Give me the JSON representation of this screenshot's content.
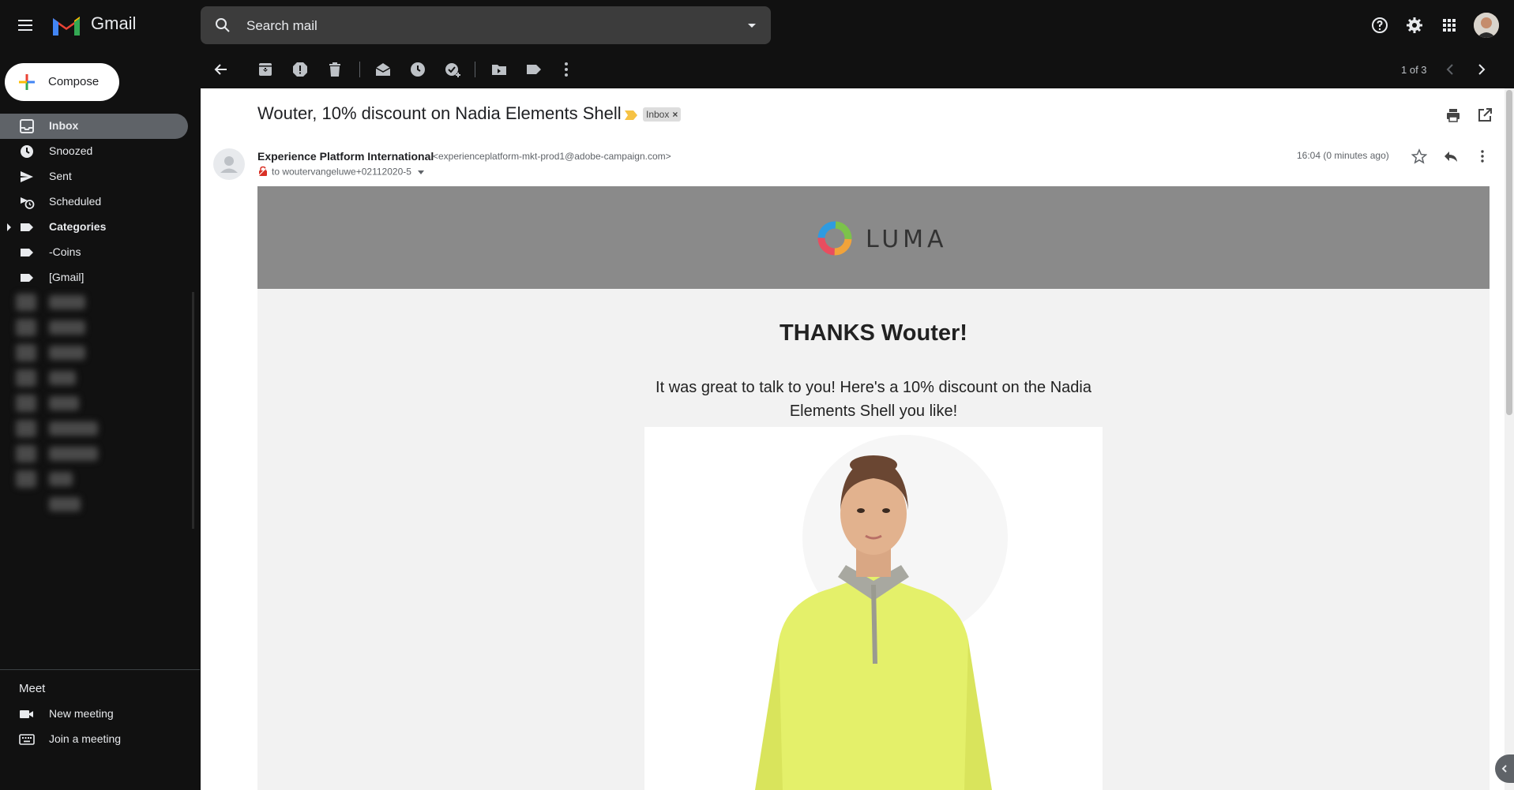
{
  "app": {
    "logo_label": "Gmail",
    "search_placeholder": "Search mail"
  },
  "compose_label": "Compose",
  "sidebar": {
    "items": [
      {
        "label": "Inbox",
        "icon": "inbox-icon",
        "active": true,
        "bold": true
      },
      {
        "label": "Snoozed",
        "icon": "clock-icon"
      },
      {
        "label": "Sent",
        "icon": "send-icon"
      },
      {
        "label": "Scheduled",
        "icon": "scheduled-icon"
      },
      {
        "label": "Categories",
        "icon": "label-icon",
        "bold": true,
        "expandable": true
      },
      {
        "label": "-Coins",
        "icon": "label-icon"
      },
      {
        "label": "[Gmail]",
        "icon": "label-icon"
      }
    ],
    "meet": {
      "title": "Meet",
      "new_meeting": "New meeting",
      "join_meeting": "Join a meeting"
    }
  },
  "toolbar": {
    "count": "1 of 3"
  },
  "email": {
    "subject": "Wouter, 10% discount on Nadia Elements Shell",
    "label_chip": "Inbox",
    "chip_close": "×",
    "sender_name": "Experience Platform International",
    "sender_email": "<experienceplatform-mkt-prod1@adobe-campaign.com>",
    "recipient": "to woutervangeluwe+02112020-5",
    "timestamp": "16:04 (0 minutes ago)"
  },
  "email_body": {
    "brand": "LUMA",
    "greeting": "THANKS Wouter!",
    "message": "It was great to talk to you! Here's a 10% discount on the Nadia Elements Shell you like!"
  },
  "colors": {
    "app_background": "#111111",
    "accent_active": "#5f6368",
    "banner": "#8a8a8a",
    "product_jacket": "#e4f06a"
  }
}
